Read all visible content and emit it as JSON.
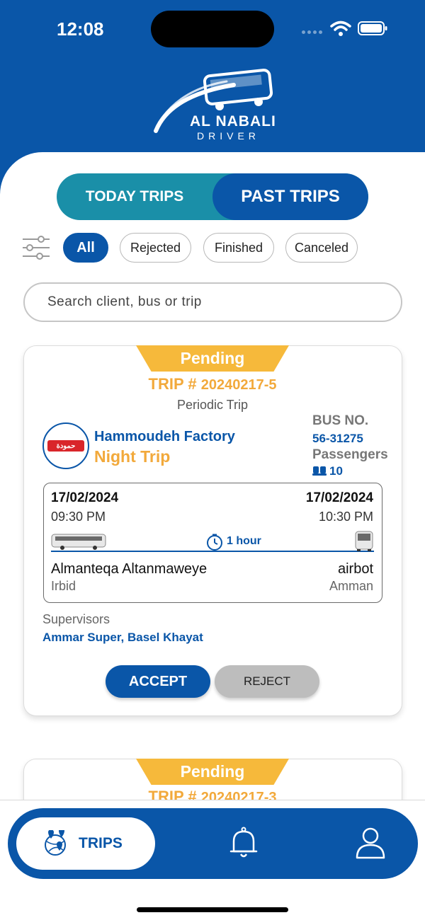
{
  "status_bar": {
    "time": "12:08"
  },
  "brand": {
    "name": "AL NABALI",
    "sub": "DRIVER"
  },
  "tabs": {
    "today": "TODAY TRIPS",
    "past": "PAST TRIPS"
  },
  "filters": [
    "All",
    "Rejected",
    "Finished",
    "Canceled"
  ],
  "search": {
    "placeholder": "Search client, bus or trip"
  },
  "trips": [
    {
      "status": "Pending",
      "trip_prefix": "TRIP #",
      "trip_number": "20240217-5",
      "trip_type": "Periodic Trip",
      "client": "Hammoudeh Factory",
      "trip_name": "Night Trip",
      "bus_label": "BUS NO.",
      "bus_number": "56-31275",
      "passengers_label": "Passengers",
      "passengers": "10",
      "departure_date": "17/02/2024",
      "departure_time": "09:30 PM",
      "arrival_date": "17/02/2024",
      "arrival_time": "10:30 PM",
      "duration": "1 hour",
      "from_place": "Almanteqa Altanmaweye",
      "from_city": "Irbid",
      "to_place": "airbot",
      "to_city": "Amman",
      "supervisors_label": "Supervisors",
      "supervisors": "Ammar Super, Basel Khayat",
      "accept_label": "ACCEPT",
      "reject_label": "REJECT"
    },
    {
      "status": "Pending",
      "trip_prefix": "TRIP #",
      "trip_number": "20240217-3"
    }
  ],
  "bottom_nav": {
    "trips_label": "TRIPS"
  },
  "colors": {
    "primary": "#0a56a8",
    "accent": "#f6b93b",
    "teal": "#1a8fa8"
  }
}
